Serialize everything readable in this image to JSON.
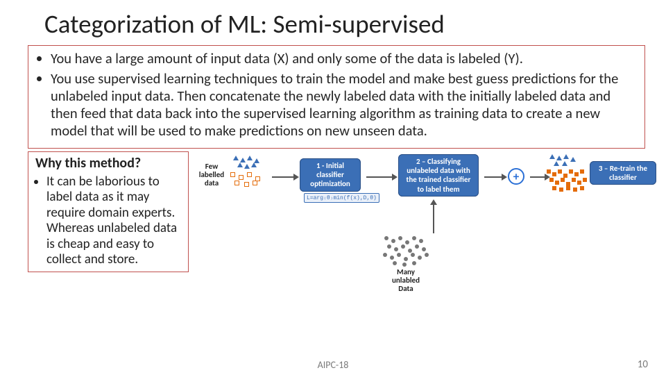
{
  "title": "Categorization of ML: Semi-supervised",
  "bullets_top": [
    "You have a large amount of input data (X) and only some of the data is labeled (Y).",
    "You use supervised learning techniques to train the model and make best guess predictions for the unlabeled input data. Then concatenate the newly labeled data with the initially labeled data and then feed that data back into the supervised learning algorithm as training data to create a new model that will be used to make predictions on new unseen data."
  ],
  "why": {
    "heading": "Why this method?",
    "points": [
      "It can be laborious to label data as it may require domain experts. Whereas unlabeled data is cheap and easy to collect and store."
    ]
  },
  "diagram": {
    "few_labeled": "Few\nlabelled\ndata",
    "many_unlabeled": "Many\nunlabled\nData",
    "step1": "1 - Initial\nclassifier\noptimization",
    "step2": "2 – Classifying\nunlabeled data with\nthe trained classifier\nto label them",
    "step3": "3 – Re-train the\nclassifier",
    "formula": "L=arg₍θ₎min(f(x),D,θ)",
    "plus": "+"
  },
  "footer": {
    "center": "AIPC-18",
    "page": "10"
  }
}
